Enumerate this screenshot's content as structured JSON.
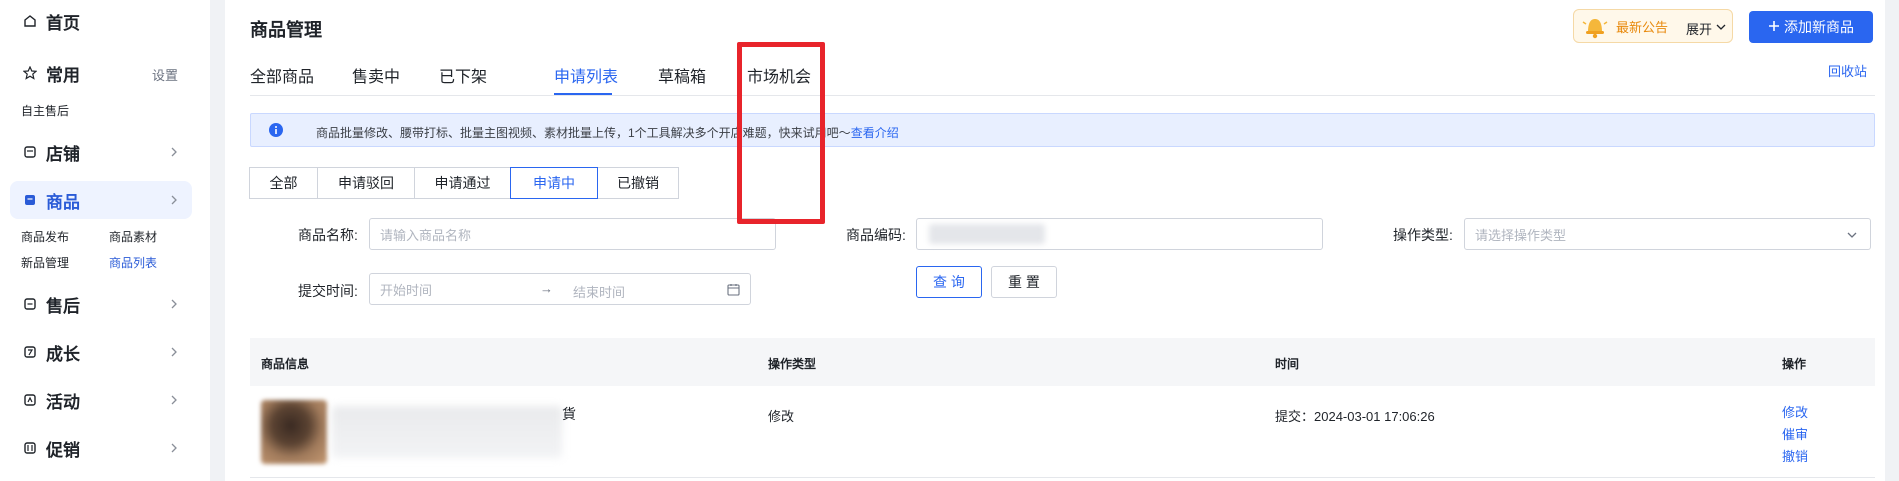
{
  "sidebar": {
    "home": "首页",
    "common": "常用",
    "common_settings": "设置",
    "common_sub": "自主售后",
    "store": "店铺",
    "goods": "商品",
    "goods_subs": [
      "商品发布",
      "商品素材",
      "新品管理",
      "商品列表"
    ],
    "after_sale": "售后",
    "growth": "成长",
    "activity": "活动",
    "promotion": "促销"
  },
  "header": {
    "title": "商品管理",
    "notice_text": "最新公告",
    "notice_expand": "展开",
    "add_button": "添加新商品",
    "recycle": "回收站"
  },
  "tabs": [
    "全部商品",
    "售卖中",
    "已下架",
    "申请列表",
    "草稿箱",
    "市场机会"
  ],
  "info_bar": {
    "message": "商品批量修改、腰带打标、批量主图视频、素材批量上传，1个工具解决多个开店难题，快来试用吧～",
    "link": "查看介绍"
  },
  "status_filters": [
    "全部",
    "申请驳回",
    "申请通过",
    "申请中",
    "已撤销"
  ],
  "filters": {
    "name_label": "商品名称:",
    "name_placeholder": "请输入商品名称",
    "code_label": "商品编码:",
    "op_type_label": "操作类型:",
    "op_type_placeholder": "请选择操作类型",
    "submit_time_label": "提交时间:",
    "start_placeholder": "开始时间",
    "end_placeholder": "结束时间",
    "range_arrow": "→",
    "query": "查 询",
    "reset": "重 置"
  },
  "table": {
    "columns": [
      "商品信息",
      "操作类型",
      "时间",
      "操作"
    ],
    "rows": [
      {
        "title_tail": "貨",
        "op_type": "修改",
        "time": "提交：2024-03-01 17:06:26",
        "actions": [
          "修改",
          "催审",
          "撤销"
        ]
      }
    ]
  }
}
